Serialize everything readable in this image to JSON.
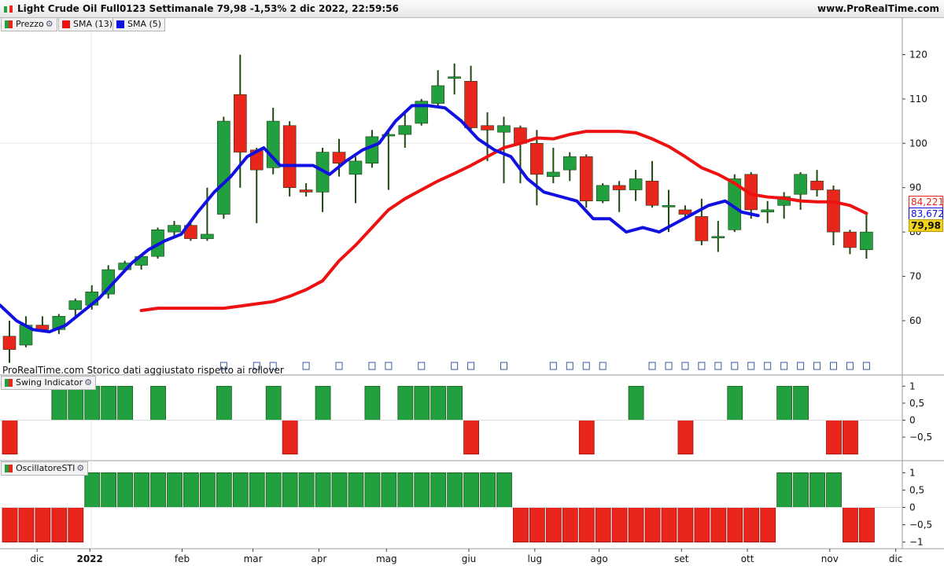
{
  "header": {
    "title": "Light Crude Oil Full0123 Settimanale 79,98 -1,53% 2 dic 2022, 22:59:56",
    "site": "www.ProRealTime.com"
  },
  "legend": {
    "price": "Prezzo",
    "sma13": "SMA (13)",
    "sma5": "SMA (5)",
    "swing": "Swing Indicator",
    "osc": "OscillatoreSTI"
  },
  "note": "ProRealTime.com Storico dati aggiustato rispetto ai rollover",
  "price_tags": {
    "sma13": "84,221",
    "sma5": "83,672",
    "last": "79,98"
  },
  "colors": {
    "up": "#22a040",
    "down": "#e8261c",
    "sma13": "#ee1111",
    "sma5": "#1010e0",
    "grid": "#e6e6e6"
  },
  "chart_data": [
    {
      "type": "candlestick",
      "title": "Light Crude Oil Full0123 Settimanale",
      "x_labels": [
        "dic",
        "2022",
        "feb",
        "mar",
        "apr",
        "mag",
        "giu",
        "lug",
        "ago",
        "set",
        "ott",
        "nov",
        "dic"
      ],
      "x_label_positions": [
        1.2,
        4.4,
        10.0,
        14.3,
        18.3,
        22.4,
        27.4,
        31.4,
        35.3,
        40.3,
        44.3,
        49.3,
        53.3
      ],
      "y_ticks": [
        60,
        70,
        80,
        90,
        100,
        110,
        120
      ],
      "ylim": [
        49,
        127
      ],
      "candles": [
        {
          "o": 56.5,
          "h": 60,
          "l": 50.5,
          "c": 53.5
        },
        {
          "o": 54.5,
          "h": 61,
          "l": 54,
          "c": 59
        },
        {
          "o": 59,
          "h": 61,
          "l": 57.5,
          "c": 58
        },
        {
          "o": 58,
          "h": 61.5,
          "l": 57,
          "c": 61
        },
        {
          "o": 62.5,
          "h": 65,
          "l": 60.5,
          "c": 64.5
        },
        {
          "o": 63.5,
          "h": 68,
          "l": 62.5,
          "c": 66.5
        },
        {
          "o": 66,
          "h": 72.5,
          "l": 65,
          "c": 71.5
        },
        {
          "o": 71.5,
          "h": 73.5,
          "l": 71,
          "c": 73
        },
        {
          "o": 72.5,
          "h": 75,
          "l": 71.5,
          "c": 74.5
        },
        {
          "o": 74.5,
          "h": 81,
          "l": 74,
          "c": 80.5
        },
        {
          "o": 80,
          "h": 82.5,
          "l": 79,
          "c": 81.5
        },
        {
          "o": 81.5,
          "h": 82,
          "l": 78,
          "c": 78.5
        },
        {
          "o": 78.5,
          "h": 90,
          "l": 78,
          "c": 79.5
        },
        {
          "o": 84,
          "h": 106,
          "l": 83,
          "c": 105
        },
        {
          "o": 111,
          "h": 120,
          "l": 90,
          "c": 98
        },
        {
          "o": 98.5,
          "h": 99,
          "l": 82,
          "c": 94
        },
        {
          "o": 94.5,
          "h": 108,
          "l": 93,
          "c": 105
        },
        {
          "o": 104,
          "h": 105,
          "l": 88,
          "c": 90
        },
        {
          "o": 89.5,
          "h": 91,
          "l": 88,
          "c": 89
        },
        {
          "o": 89,
          "h": 99,
          "l": 84.5,
          "c": 98
        },
        {
          "o": 98,
          "h": 101,
          "l": 92.5,
          "c": 95.5
        },
        {
          "o": 93,
          "h": 97,
          "l": 86.5,
          "c": 96
        },
        {
          "o": 95.5,
          "h": 103,
          "l": 94.5,
          "c": 101.5
        },
        {
          "o": 102,
          "h": 103,
          "l": 89.5,
          "c": 102
        },
        {
          "o": 102,
          "h": 107,
          "l": 99,
          "c": 104
        },
        {
          "o": 104.5,
          "h": 110,
          "l": 104,
          "c": 109.5
        },
        {
          "o": 109,
          "h": 116.5,
          "l": 108,
          "c": 113
        },
        {
          "o": 115,
          "h": 118,
          "l": 111,
          "c": 115
        },
        {
          "o": 114,
          "h": 117.5,
          "l": 103,
          "c": 103.5
        },
        {
          "o": 104,
          "h": 107,
          "l": 96,
          "c": 103
        },
        {
          "o": 102.5,
          "h": 106,
          "l": 91,
          "c": 104
        },
        {
          "o": 103.5,
          "h": 104,
          "l": 91,
          "c": 100
        },
        {
          "o": 100,
          "h": 103,
          "l": 86,
          "c": 93
        },
        {
          "o": 92.5,
          "h": 99,
          "l": 91,
          "c": 93.5
        },
        {
          "o": 94,
          "h": 98,
          "l": 91.5,
          "c": 97
        },
        {
          "o": 97,
          "h": 97.5,
          "l": 85.5,
          "c": 87
        },
        {
          "o": 87,
          "h": 91,
          "l": 86.5,
          "c": 90.5
        },
        {
          "o": 90.5,
          "h": 91.5,
          "l": 84.5,
          "c": 89.5
        },
        {
          "o": 89.5,
          "h": 94,
          "l": 87,
          "c": 92
        },
        {
          "o": 91.5,
          "h": 96,
          "l": 85.5,
          "c": 86
        },
        {
          "o": 86,
          "h": 89.5,
          "l": 80,
          "c": 86
        },
        {
          "o": 85,
          "h": 86,
          "l": 83,
          "c": 84
        },
        {
          "o": 83.5,
          "h": 87.5,
          "l": 77,
          "c": 78
        },
        {
          "o": 79,
          "h": 82.5,
          "l": 75.5,
          "c": 79
        },
        {
          "o": 80.5,
          "h": 93,
          "l": 80,
          "c": 92
        },
        {
          "o": 93,
          "h": 93.5,
          "l": 83,
          "c": 85
        },
        {
          "o": 84.5,
          "h": 87,
          "l": 82,
          "c": 85
        },
        {
          "o": 86,
          "h": 89,
          "l": 83,
          "c": 88
        },
        {
          "o": 88.5,
          "h": 93.5,
          "l": 85,
          "c": 93
        },
        {
          "o": 91.5,
          "h": 94,
          "l": 88,
          "c": 89.5
        },
        {
          "o": 89.5,
          "h": 90.5,
          "l": 77,
          "c": 80
        },
        {
          "o": 80,
          "h": 80.5,
          "l": 75,
          "c": 76.5
        },
        {
          "o": 76,
          "h": 84,
          "l": 74,
          "c": 80
        }
      ],
      "series": [
        {
          "name": "SMA (13)",
          "values": [
            62.3,
            62.8,
            62.8,
            62.8,
            62.8,
            62.8,
            63.3,
            63.8,
            64.3,
            65.5,
            67,
            69,
            73.5,
            77,
            81,
            85,
            87.5,
            89.5,
            91.5,
            93.2,
            95,
            97,
            99,
            100,
            101.2,
            101,
            102,
            102.7,
            102.7,
            102.7,
            102.4,
            101,
            99.3,
            97,
            94.5,
            93,
            91,
            88.5,
            87.9,
            87.6,
            87,
            86.8,
            86.8,
            86,
            84.2
          ]
        },
        {
          "name": "SMA (5)",
          "values": [
            63.5,
            60,
            58,
            57.5,
            59,
            62,
            65,
            69,
            73,
            76,
            78,
            79.5,
            84.5,
            89,
            92.5,
            97,
            99,
            95,
            95,
            95,
            93,
            96,
            98.5,
            100,
            105,
            108.5,
            108.5,
            108,
            105,
            101,
            98.5,
            97,
            92,
            89,
            88,
            87,
            83,
            83,
            80,
            81,
            80,
            82,
            84,
            86,
            87,
            84.5,
            83.7
          ]
        }
      ],
      "series_start_index": [
        8,
        0
      ],
      "ylabel": ""
    },
    {
      "type": "bar",
      "title": "Swing Indicator",
      "y_ticks": [
        1,
        0.5,
        0,
        -0.5
      ],
      "ylim": [
        -1.1,
        1.1
      ],
      "values": [
        -1,
        0,
        0,
        1,
        1,
        1,
        1,
        1,
        0,
        1,
        0,
        0,
        0,
        1,
        0,
        0,
        1,
        -1,
        0,
        1,
        0,
        0,
        1,
        0,
        1,
        1,
        1,
        1,
        -1,
        0,
        0,
        0,
        0,
        0,
        0,
        -1,
        0,
        0,
        1,
        0,
        0,
        -1,
        0,
        0,
        1,
        0,
        0,
        1,
        1,
        0,
        -1,
        -1,
        0
      ]
    },
    {
      "type": "bar",
      "title": "OscillatoreSTI",
      "y_ticks": [
        1,
        0.5,
        0,
        -0.5,
        -1
      ],
      "ylim": [
        -1.1,
        1.1
      ],
      "values": [
        -1,
        -1,
        -1,
        -1,
        -1,
        1,
        1,
        1,
        1,
        1,
        1,
        1,
        1,
        1,
        1,
        1,
        1,
        1,
        1,
        1,
        1,
        1,
        1,
        1,
        1,
        1,
        1,
        1,
        1,
        1,
        1,
        -1,
        -1,
        -1,
        -1,
        -1,
        -1,
        -1,
        -1,
        -1,
        -1,
        -1,
        -1,
        -1,
        -1,
        -1,
        -1,
        1,
        1,
        1,
        1,
        -1,
        -1
      ]
    }
  ]
}
